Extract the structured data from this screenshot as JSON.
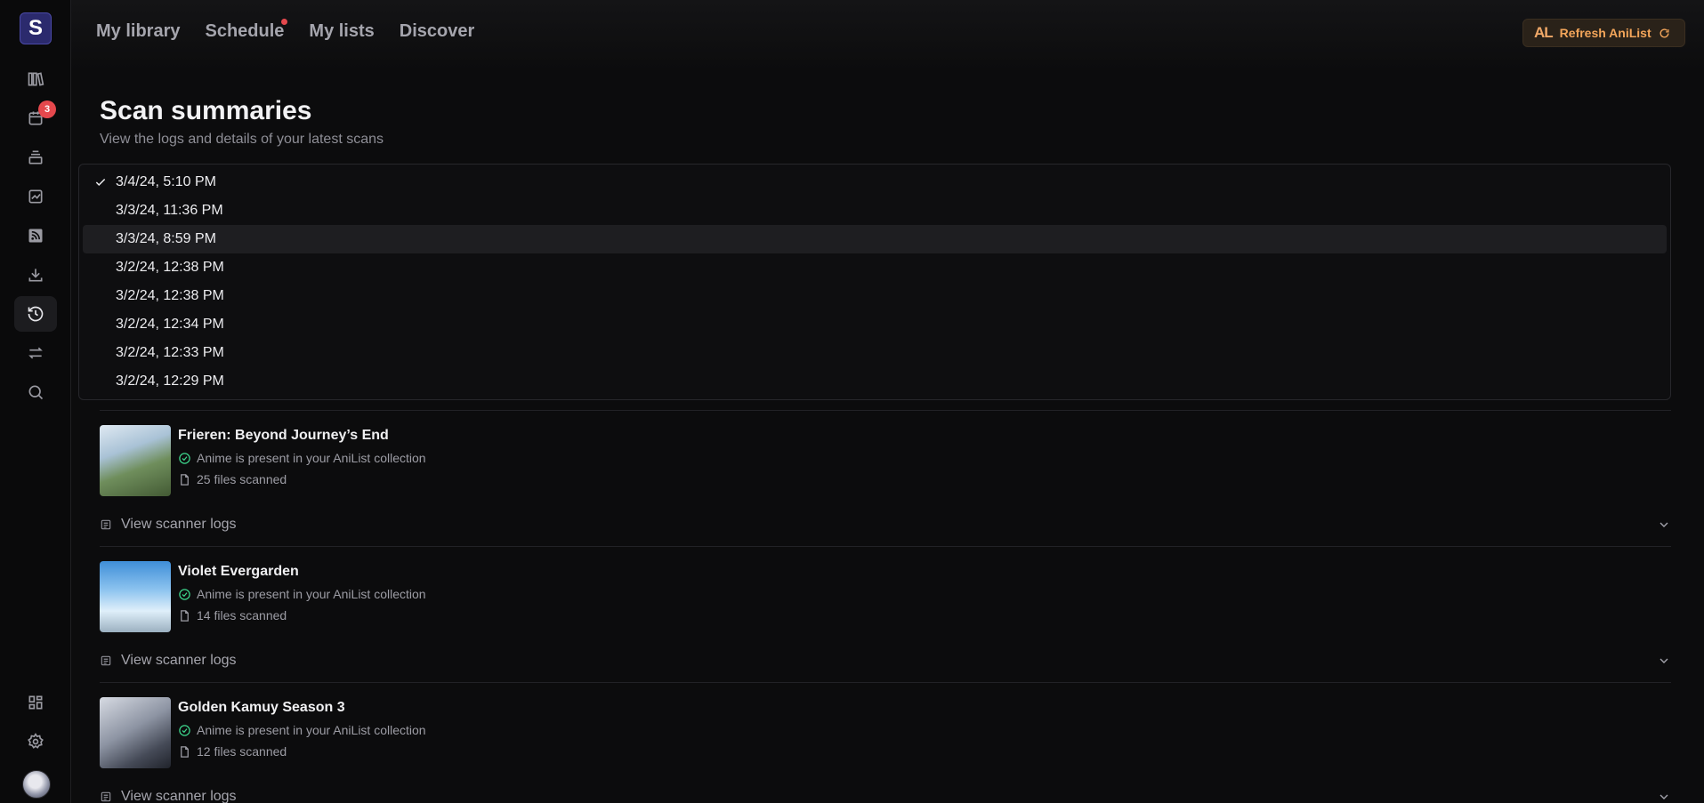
{
  "app": {
    "logo_letter": "S",
    "schedule_badge": "3"
  },
  "nav": {
    "items": [
      {
        "label": "My library"
      },
      {
        "label": "Schedule"
      },
      {
        "label": "My lists"
      },
      {
        "label": "Discover"
      }
    ],
    "refresh_label": "Refresh AniList",
    "refresh_logo": "AL"
  },
  "sidebar": {
    "icons": [
      "library-icon",
      "calendar-icon",
      "stack-icon",
      "chart-icon",
      "rss-icon",
      "download-icon",
      "history-icon",
      "transfer-icon",
      "search-icon"
    ],
    "bottom_icons": [
      "dashboard-icon",
      "gear-icon",
      "avatar"
    ],
    "active": "history-icon"
  },
  "page": {
    "title": "Scan summaries",
    "subtitle": "View the logs and details of your latest scans"
  },
  "scan_select": {
    "selected": "3/4/24, 5:10 PM",
    "highlighted": "3/3/24, 8:59 PM",
    "options": [
      "3/4/24, 5:10 PM",
      "3/3/24, 11:36 PM",
      "3/3/24, 8:59 PM",
      "3/2/24, 12:38 PM",
      "3/2/24, 12:38 PM",
      "3/2/24, 12:34 PM",
      "3/2/24, 12:33 PM",
      "3/2/24, 12:29 PM"
    ]
  },
  "entries": [
    {
      "title": "Frieren: Beyond Journey’s End",
      "status": "Anime is present in your AniList collection",
      "files": "25 files scanned",
      "logs_label": "View scanner logs"
    },
    {
      "title": "Violet Evergarden",
      "status": "Anime is present in your AniList collection",
      "files": "14 files scanned",
      "logs_label": "View scanner logs"
    },
    {
      "title": "Golden Kamuy Season 3",
      "status": "Anime is present in your AniList collection",
      "files": "12 files scanned",
      "logs_label": "View scanner logs"
    }
  ],
  "colors": {
    "accent_orange": "#f3a55a",
    "badge_red": "#e5484d",
    "success_green": "#3dd68c",
    "logo_purple": "#2b2a6d"
  }
}
